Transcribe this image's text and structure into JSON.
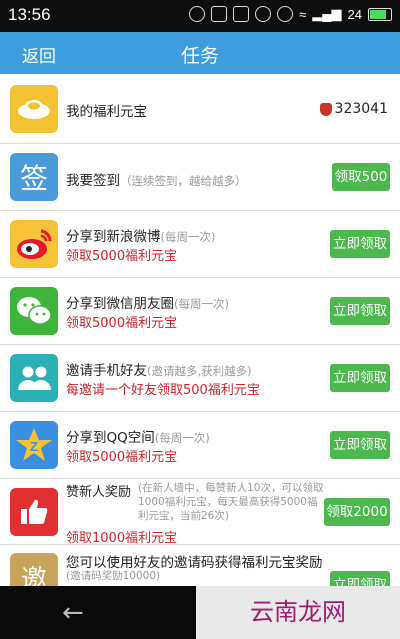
{
  "status_bar": {
    "time": "13:56",
    "battery": "24"
  },
  "header": {
    "back_label": "返回",
    "title": "任务"
  },
  "tasks": [
    {
      "name": "我的福利元宝",
      "coins": "323041"
    },
    {
      "name": "我要签到",
      "note": "（连续签到，越给越多）",
      "icon_char": "签",
      "button": "领取500"
    },
    {
      "name": "分享到新浪微博",
      "note": "(每周一次)",
      "reward": "领取5000福利元宝",
      "button": "立即领取"
    },
    {
      "name": "分享到微信朋友圈",
      "note": "(每周一次)",
      "reward": "领取5000福利元宝",
      "button": "立即领取"
    },
    {
      "name": "邀请手机好友",
      "note": "(邀请越多,获利越多)",
      "reward": "每邀请一个好友领取500福利元宝",
      "button": "立即领取"
    },
    {
      "name": "分享到QQ空间",
      "note": "(每周一次)",
      "reward": "领取5000福利元宝",
      "button": "立即领取"
    },
    {
      "name": "赞新人奖励",
      "note": "(在新人墙中，每赞新人10次，可以领取1000福利元宝，每天最高获得5000福利元宝，当前26次)",
      "reward": "领取1000福利元宝",
      "button": "领取2000"
    },
    {
      "name": "您可以使用好友的邀请码获得福利元宝奖励",
      "note": "(邀请码奖励10000)",
      "icon_char": "邀",
      "button": "立即领取"
    }
  ],
  "watermark": "云南龙网"
}
